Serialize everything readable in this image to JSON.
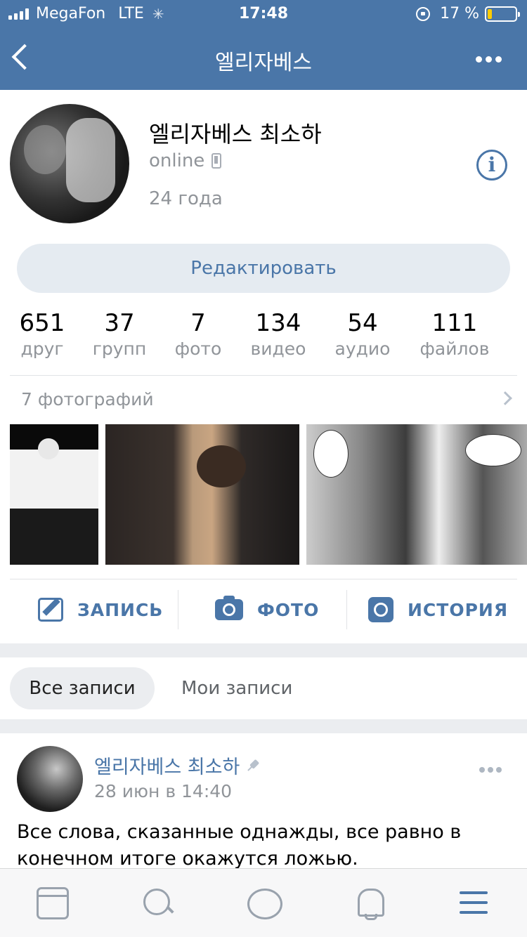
{
  "status_bar": {
    "carrier": "MegaFon",
    "network": "LTE",
    "time": "17:48",
    "battery": "17 %",
    "battery_level": 0.17
  },
  "nav": {
    "title": "엘리자베스",
    "back_icon": "chevron-left-icon",
    "more_icon": "more-horizontal-icon"
  },
  "profile": {
    "name": "엘리자베스 최소하",
    "status": "online",
    "age": "24 года",
    "edit_label": "Редактировать"
  },
  "counters": [
    {
      "value": "651",
      "label": "друг"
    },
    {
      "value": "37",
      "label": "групп"
    },
    {
      "value": "7",
      "label": "фото"
    },
    {
      "value": "134",
      "label": "видео"
    },
    {
      "value": "54",
      "label": "аудио"
    },
    {
      "value": "111",
      "label": "файлов"
    }
  ],
  "photos": {
    "title": "7 фотографий"
  },
  "actions": {
    "post": "ЗАПИСЬ",
    "photo": "ФОТО",
    "story": "ИСТОРИЯ"
  },
  "filters": {
    "all": "Все записи",
    "mine": "Мои записи"
  },
  "post": {
    "author": "엘리자베스 최소하",
    "date": "28 июн в 14:40",
    "text": "Все слова, сказанные однажды, все равно в конечном итоге окажутся ложью."
  },
  "colors": {
    "brand": "#4a76a8",
    "secondary_text": "#909499",
    "battery_fill": "#ffcc00"
  }
}
